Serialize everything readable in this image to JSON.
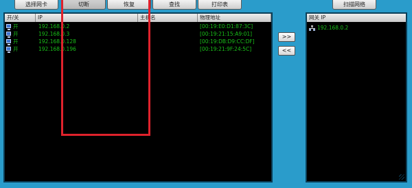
{
  "toolbar": {
    "select_nic": "选择网卡",
    "cut": "切断",
    "restore": "恢复",
    "search": "查找",
    "print": "打印表",
    "scan_network": "扫描网络"
  },
  "host_table": {
    "headers": {
      "on_off": "开/关",
      "ip": "IP",
      "hostname": "主机名",
      "mac": "物理地址"
    },
    "rows": [
      {
        "state": "开",
        "ip": "192.168.0.2",
        "hostname": "",
        "mac": "[00:19:E0:D1:87:3C]"
      },
      {
        "state": "开",
        "ip": "192.168.0.3",
        "hostname": "",
        "mac": "[00:19:21:15:A9:01]"
      },
      {
        "state": "开",
        "ip": "192.168.0.128",
        "hostname": "",
        "mac": "[00:19:DB:D9:CC:DF]"
      },
      {
        "state": "开",
        "ip": "192.168.0.196",
        "hostname": "",
        "mac": "[00:19:21:9F:24:5C]"
      }
    ]
  },
  "move_buttons": {
    "add": ">>",
    "remove": "<<"
  },
  "gateway_table": {
    "header": "网关 IP",
    "rows": [
      {
        "ip": "192.168.0.2"
      }
    ]
  },
  "colors": {
    "background": "#2a9ccb",
    "list_text": "#19c019",
    "highlight_box": "#e0222c"
  },
  "icons": {
    "host": "computer-icon",
    "gateway": "network-hub-icon"
  }
}
